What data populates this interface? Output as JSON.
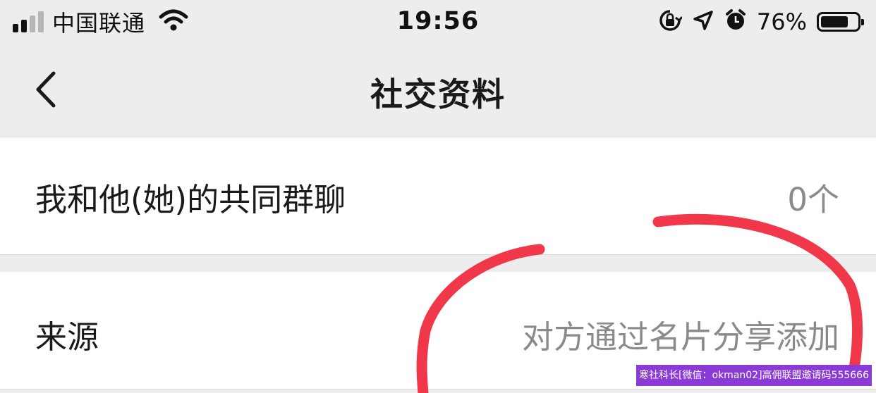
{
  "status_bar": {
    "carrier": "中国联通",
    "time": "19:56",
    "battery_percent": "76%",
    "battery_level": 0.76,
    "icons": [
      "signal-icon",
      "wifi-icon",
      "orientation-lock-icon",
      "location-icon",
      "alarm-icon",
      "battery-icon"
    ]
  },
  "nav": {
    "title": "社交资料",
    "back_icon": "chevron-left-icon"
  },
  "rows": {
    "common_groups": {
      "label": "我和他(她)的共同群聊",
      "value": "0个"
    },
    "source": {
      "label": "来源",
      "value": "对方通过名片分享添加"
    }
  },
  "annotation_color": "#f0384a",
  "watermark": "寒社科长[微信：okman02]高佣联盟邀请码555666"
}
